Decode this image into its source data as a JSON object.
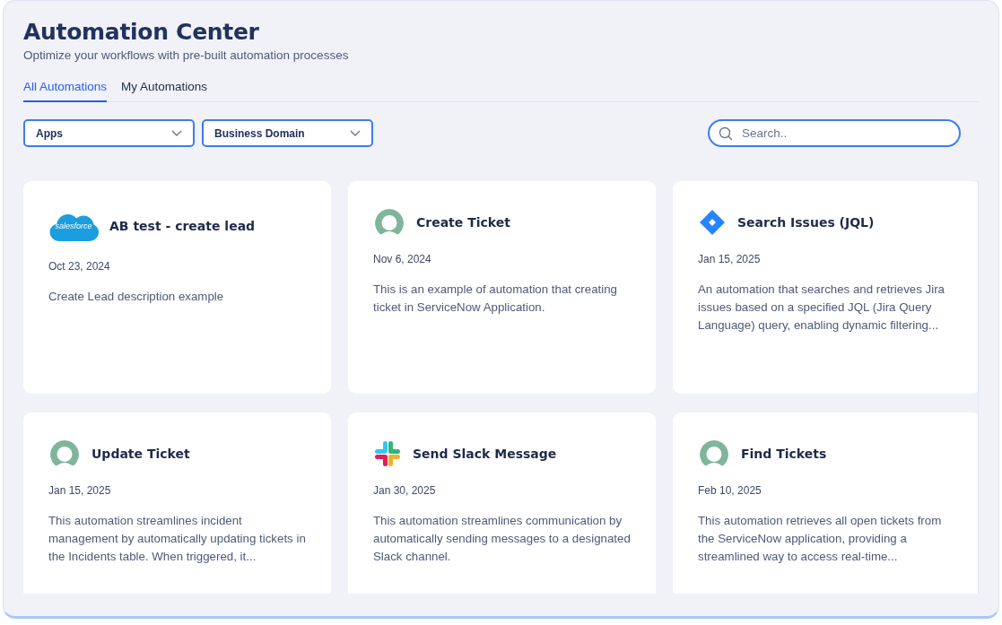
{
  "header": {
    "title": "Automation Center",
    "subtitle": "Optimize your workflows with pre-built automation processes"
  },
  "tabs": [
    {
      "label": "All Automations",
      "selected": true
    },
    {
      "label": "My Automations",
      "selected": false
    }
  ],
  "filters": [
    {
      "label": "Apps"
    },
    {
      "label": "Business Domain"
    }
  ],
  "search": {
    "placeholder": "Search.."
  },
  "cards": [
    {
      "kind": "salesforce",
      "logo_text": "salesforce",
      "title": "AB test - create lead",
      "date": "Oct 23, 2024",
      "description": "Create Lead description example"
    },
    {
      "kind": "servicenow",
      "title": "Create Ticket",
      "date": "Nov 6, 2024",
      "description": "This is an example of automation that creating ticket in ServiceNow Application."
    },
    {
      "kind": "jira",
      "title": "Search Issues (JQL)",
      "date": "Jan 15, 2025",
      "description": "An automation that searches and retrieves Jira issues based on a specified JQL (Jira Query Language) query, enabling dynamic filtering..."
    },
    {
      "kind": "servicenow",
      "title": "Update Ticket",
      "date": "Jan 15, 2025",
      "description": "This automation streamlines incident management by automatically updating tickets in the Incidents table. When triggered, it..."
    },
    {
      "kind": "slack",
      "title": "Send Slack Message",
      "date": "Jan 30, 2025",
      "description": "This automation streamlines communication by automatically sending messages to a designated Slack channel."
    },
    {
      "kind": "servicenow",
      "title": "Find Tickets",
      "date": "Feb 10, 2025",
      "description": "This automation retrieves all open tickets from the ServiceNow application, providing a streamlined way to access real-time..."
    }
  ]
}
